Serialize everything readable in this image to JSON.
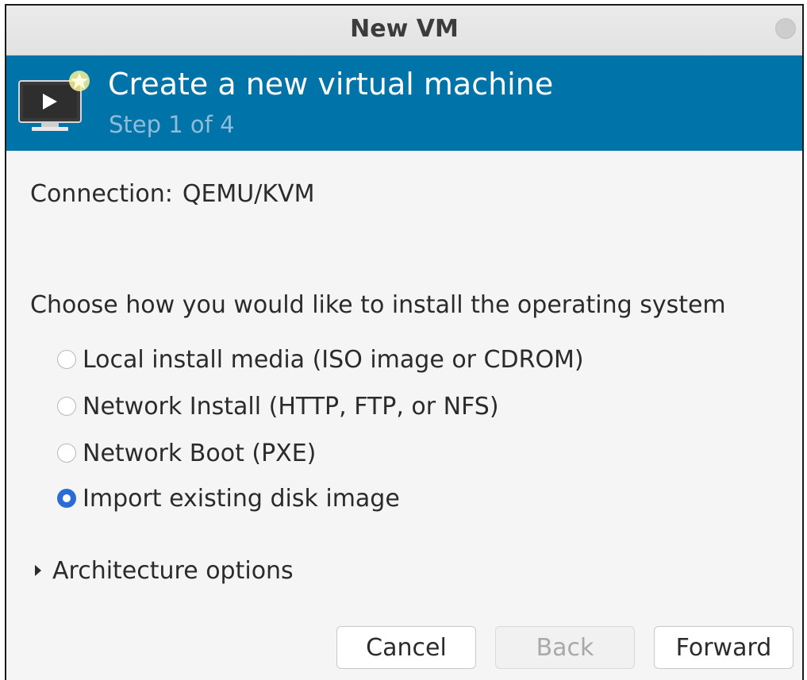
{
  "window": {
    "title": "New VM"
  },
  "banner": {
    "heading": "Create a new virtual machine",
    "step": "Step 1 of 4",
    "icon": "vm-monitor-new-icon",
    "background_color": "#0074a8"
  },
  "connection": {
    "label": "Connection:",
    "value": "QEMU/KVM"
  },
  "install": {
    "prompt": "Choose how you would like to install the operating system",
    "options": [
      {
        "label": "Local install media (ISO image or CDROM)",
        "selected": false
      },
      {
        "label": "Network Install (HTTP, FTP, or NFS)",
        "selected": false
      },
      {
        "label": "Network Boot (PXE)",
        "selected": false
      },
      {
        "label": "Import existing disk image",
        "selected": true
      }
    ]
  },
  "architecture": {
    "label": "Architecture options",
    "expanded": false
  },
  "buttons": {
    "cancel": "Cancel",
    "back": "Back",
    "forward": "Forward",
    "back_enabled": false
  }
}
